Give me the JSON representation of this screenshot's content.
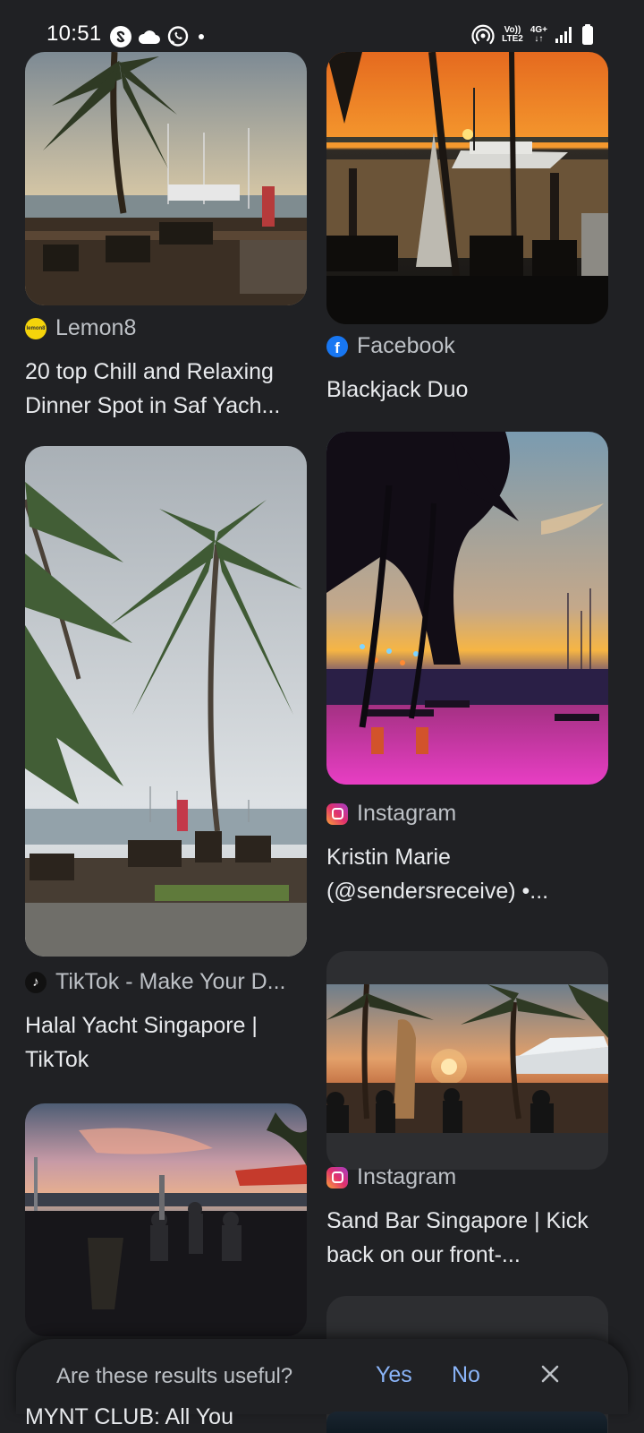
{
  "status_bar": {
    "time": "10:51",
    "volte": "Vo))",
    "lte": "LTE2",
    "network": "4G+"
  },
  "results": [
    {
      "source": "Lemon8",
      "title": "20 top Chill and Relaxing Dinner Spot in Saf Yach..."
    },
    {
      "source": "Facebook",
      "title": "Blackjack Duo"
    },
    {
      "source": "TikTok - Make Your D...",
      "title": "Halal Yacht Singapore | TikTok"
    },
    {
      "source": "Instagram",
      "title": "Kristin Marie (@sendersreceive) •..."
    },
    {
      "source": "Instagram",
      "title": "Sand Bar Singapore | Kick back on our front-..."
    },
    {
      "title_partial": "MYNT CLUB: All You"
    }
  ],
  "feedback": {
    "question": "Are these results useful?",
    "yes": "Yes",
    "no": "No"
  },
  "icons": {
    "status_left": [
      "shazam-icon",
      "cloud-icon",
      "whatsapp-icon",
      "dot-icon"
    ],
    "status_right": [
      "hotspot-icon",
      "signal-icon",
      "battery-icon"
    ],
    "sources": [
      "lemon8-icon",
      "facebook-icon",
      "tiktok-icon",
      "instagram-icon"
    ],
    "close": "close-icon"
  },
  "colors": {
    "background": "#202124",
    "text": "#e8eaed",
    "secondary_text": "#bdc1c6",
    "link": "#8ab4f8"
  }
}
